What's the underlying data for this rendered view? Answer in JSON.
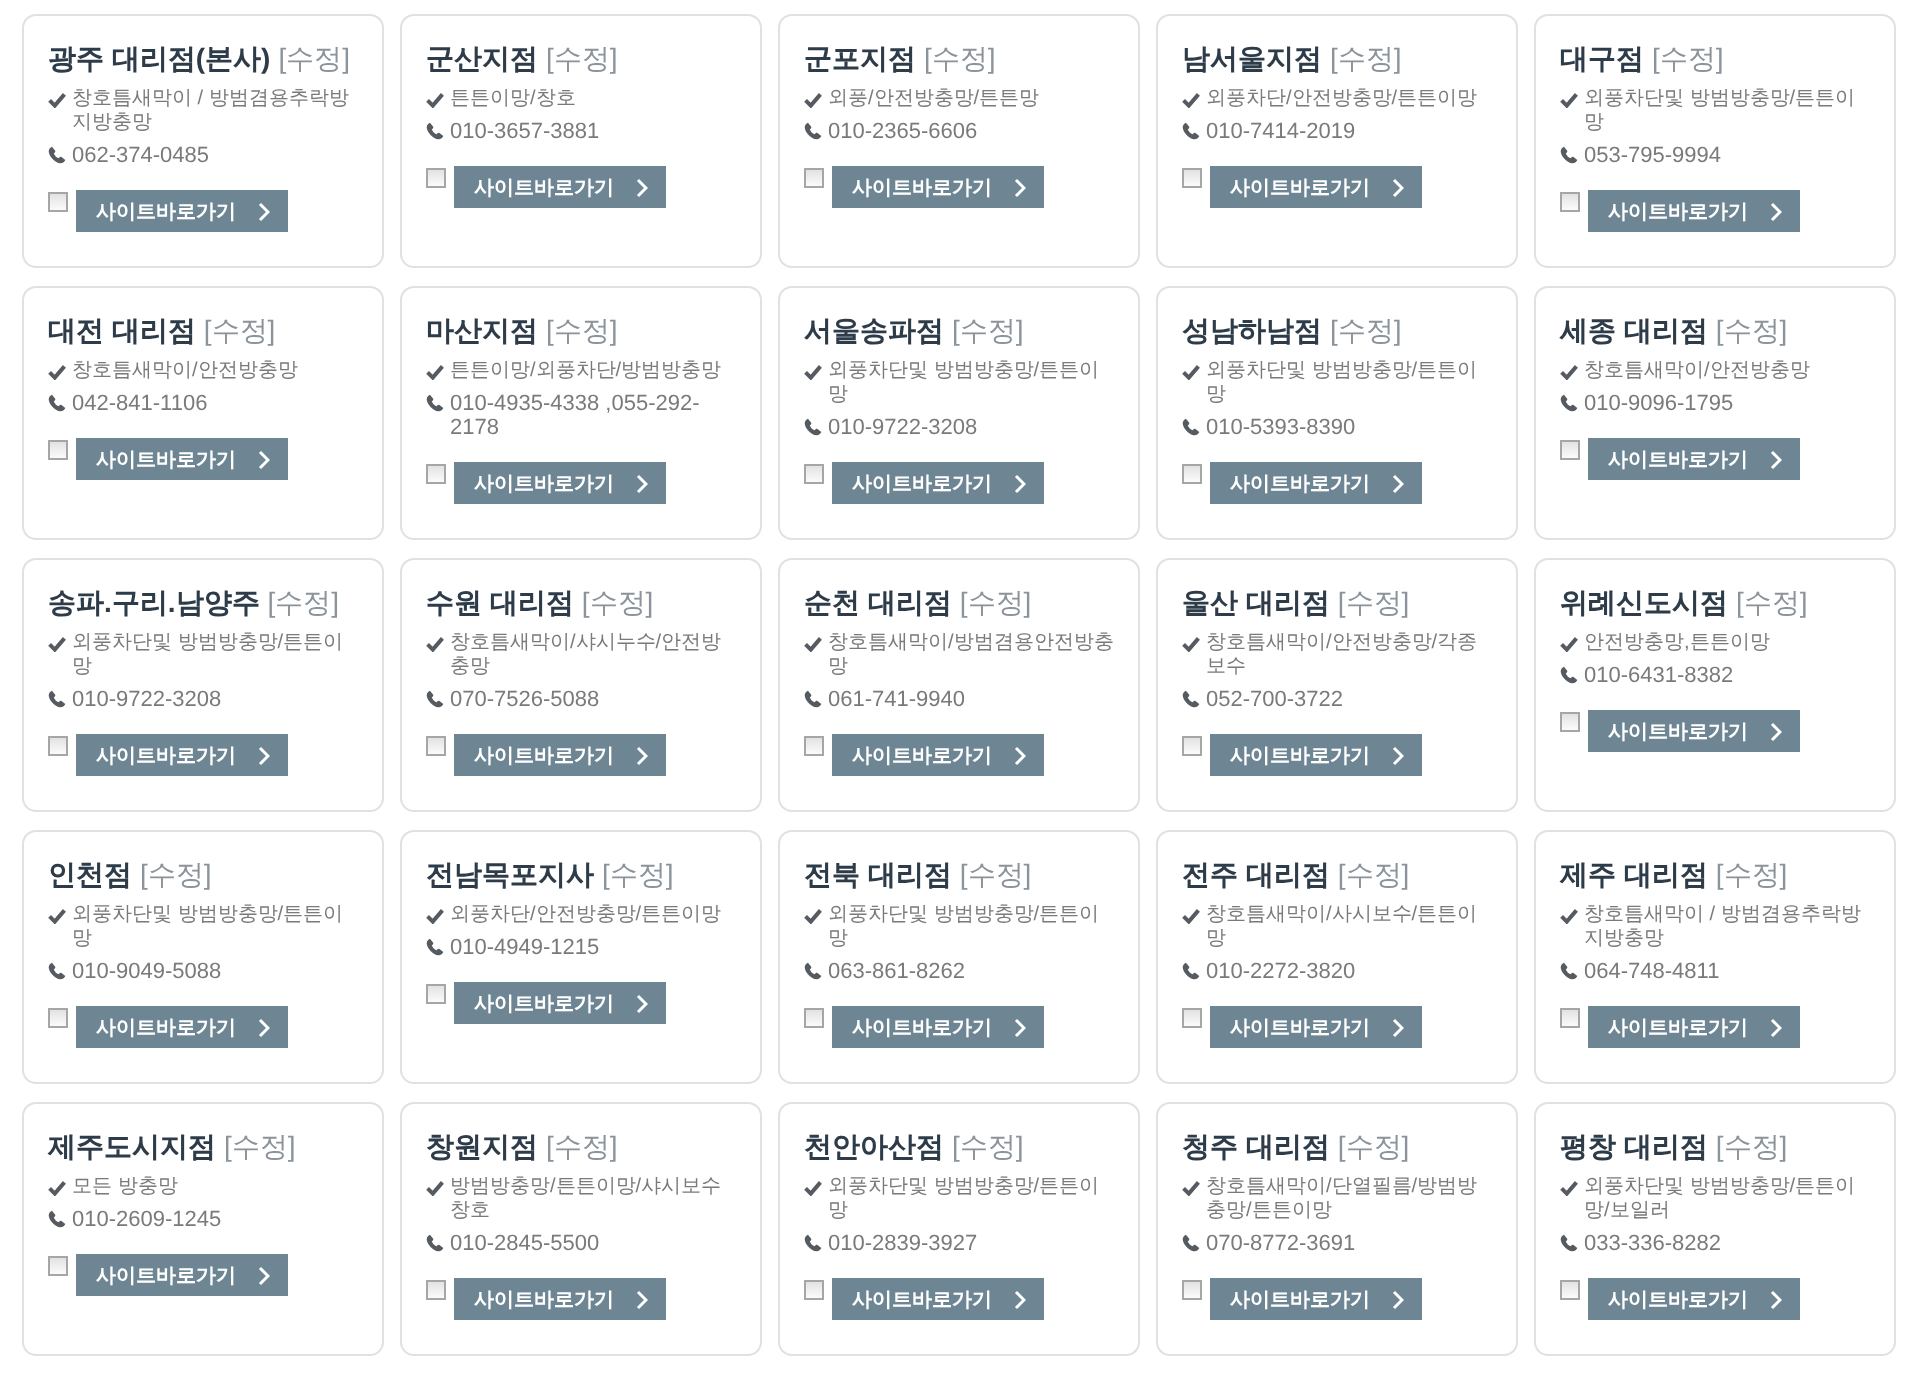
{
  "branches": [
    {
      "name": "광주 대리점(본사)",
      "edit": "[수정]",
      "services": "창호틈새막이 / 방범겸용추락방지방충망",
      "phone": "062-374-0485",
      "checked": false,
      "button": "사이트바로가기"
    },
    {
      "name": "군산지점",
      "edit": "[수정]",
      "services": "튼튼이망/창호",
      "phone": "010-3657-3881",
      "checked": false,
      "button": "사이트바로가기"
    },
    {
      "name": "군포지점",
      "edit": "[수정]",
      "services": "외풍/안전방충망/튼튼망",
      "phone": "010-2365-6606",
      "checked": false,
      "button": "사이트바로가기"
    },
    {
      "name": "남서울지점",
      "edit": "[수정]",
      "services": "외풍차단/안전방충망/튼튼이망",
      "phone": "010-7414-2019",
      "checked": false,
      "button": "사이트바로가기"
    },
    {
      "name": "대구점",
      "edit": "[수정]",
      "services": "외풍차단및 방범방충망/튼튼이망",
      "phone": "053-795-9994",
      "checked": false,
      "button": "사이트바로가기"
    },
    {
      "name": "대전 대리점",
      "edit": "[수정]",
      "services": "창호틈새막이/안전방충망",
      "phone": "042-841-1106",
      "checked": false,
      "button": "사이트바로가기"
    },
    {
      "name": "마산지점",
      "edit": "[수정]",
      "services": "튼튼이망/외풍차단/방범방충망",
      "phone": "010-4935-4338 ,055-292-2178",
      "checked": false,
      "button": "사이트바로가기"
    },
    {
      "name": "서울송파점",
      "edit": "[수정]",
      "services": "외풍차단및 방범방충망/튼튼이망",
      "phone": "010-9722-3208",
      "checked": false,
      "button": "사이트바로가기"
    },
    {
      "name": "성남하남점",
      "edit": "[수정]",
      "services": "외풍차단및 방범방충망/튼튼이망",
      "phone": "010-5393-8390",
      "checked": false,
      "button": "사이트바로가기"
    },
    {
      "name": "세종 대리점",
      "edit": "[수정]",
      "services": "창호틈새막이/안전방충망",
      "phone": "010-9096-1795",
      "checked": false,
      "button": "사이트바로가기"
    },
    {
      "name": "송파.구리.남양주",
      "edit": "[수정]",
      "services": "외풍차단및 방범방충망/튼튼이망",
      "phone": "010-9722-3208",
      "checked": false,
      "button": "사이트바로가기"
    },
    {
      "name": "수원 대리점",
      "edit": "[수정]",
      "services": "창호틈새막이/샤시누수/안전방충망",
      "phone": "070-7526-5088",
      "checked": false,
      "button": "사이트바로가기"
    },
    {
      "name": "순천 대리점",
      "edit": "[수정]",
      "services": "창호틈새막이/방범겸용안전방충망",
      "phone": "061-741-9940",
      "checked": false,
      "button": "사이트바로가기"
    },
    {
      "name": "울산 대리점",
      "edit": "[수정]",
      "services": "창호틈새막이/안전방충망/각종보수",
      "phone": "052-700-3722",
      "checked": false,
      "button": "사이트바로가기"
    },
    {
      "name": "위례신도시점",
      "edit": "[수정]",
      "services": "안전방충망,튼튼이망",
      "phone": "010-6431-8382",
      "checked": false,
      "button": "사이트바로가기"
    },
    {
      "name": "인천점",
      "edit": "[수정]",
      "services": "외풍차단및 방범방충망/튼튼이망",
      "phone": "010-9049-5088",
      "checked": false,
      "button": "사이트바로가기"
    },
    {
      "name": "전남목포지사",
      "edit": "[수정]",
      "services": "외풍차단/안전방충망/튼튼이망",
      "phone": "010-4949-1215",
      "checked": false,
      "button": "사이트바로가기"
    },
    {
      "name": "전북 대리점",
      "edit": "[수정]",
      "services": "외풍차단및 방범방충망/튼튼이망",
      "phone": "063-861-8262",
      "checked": false,
      "button": "사이트바로가기"
    },
    {
      "name": "전주 대리점",
      "edit": "[수정]",
      "services": "창호틈새막이/사시보수/튼튼이망",
      "phone": "010-2272-3820",
      "checked": false,
      "button": "사이트바로가기"
    },
    {
      "name": "제주 대리점",
      "edit": "[수정]",
      "services": "창호틈새막이 / 방범겸용추락방지방충망",
      "phone": "064-748-4811",
      "checked": false,
      "button": "사이트바로가기"
    },
    {
      "name": "제주도시지점",
      "edit": "[수정]",
      "services": "모든 방충망",
      "phone": "010-2609-1245",
      "checked": false,
      "button": "사이트바로가기"
    },
    {
      "name": "창원지점",
      "edit": "[수정]",
      "services": "방범방충망/튼튼이망/샤시보수창호",
      "phone": "010-2845-5500",
      "checked": false,
      "button": "사이트바로가기"
    },
    {
      "name": "천안아산점",
      "edit": "[수정]",
      "services": "외풍차단및 방범방충망/튼튼이망",
      "phone": "010-2839-3927",
      "checked": false,
      "button": "사이트바로가기"
    },
    {
      "name": "청주 대리점",
      "edit": "[수정]",
      "services": "창호틈새막이/단열필름/방범방충망/튼튼이망",
      "phone": "070-8772-3691",
      "checked": false,
      "button": "사이트바로가기"
    },
    {
      "name": "평창 대리점",
      "edit": "[수정]",
      "services": "외풍차단및 방범방충망/튼튼이망/보일러",
      "phone": "033-336-8282",
      "checked": false,
      "button": "사이트바로가기"
    }
  ]
}
